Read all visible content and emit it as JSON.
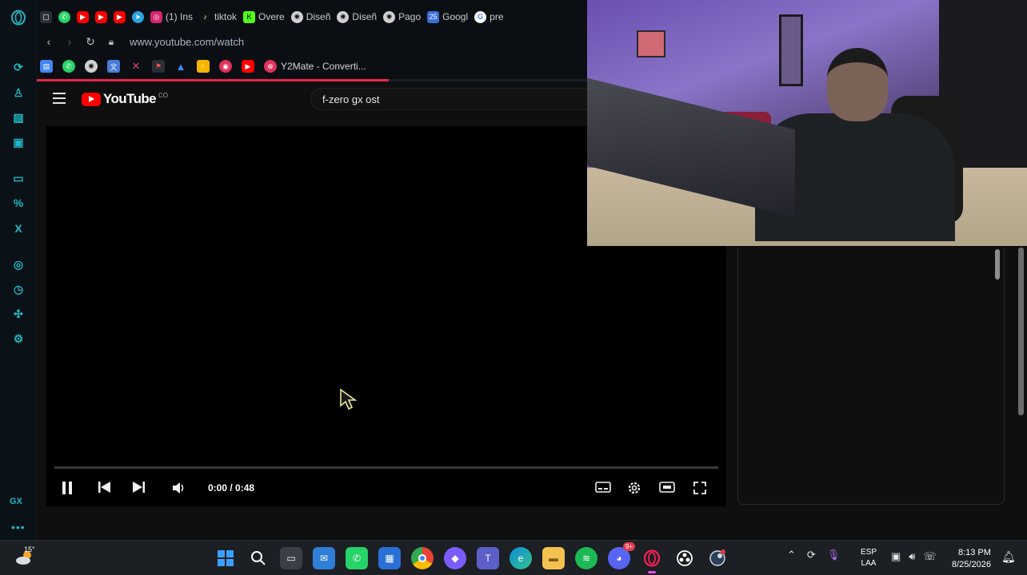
{
  "browser": {
    "tabs": [
      {
        "icon": "whatsapp-icon",
        "label": "",
        "color": "#25d366"
      },
      {
        "icon": "youtube-icon",
        "label": "",
        "color": "#ff0000"
      },
      {
        "icon": "youtube-icon",
        "label": "",
        "color": "#ff0000"
      },
      {
        "icon": "youtube-icon",
        "label": "",
        "color": "#ff0000"
      },
      {
        "icon": "telegram-icon",
        "label": "",
        "color": "#2aa3e0"
      },
      {
        "icon": "instagram-icon",
        "label": "(1) Ins",
        "color": "#d6246e"
      },
      {
        "icon": "tiktok-icon",
        "label": "tiktok",
        "color": "#111111"
      },
      {
        "icon": "kick-icon",
        "label": "Overe",
        "color": "#53fc18"
      },
      {
        "icon": "chatgpt-icon",
        "label": "Diseñ",
        "color": "#d0d0d0"
      },
      {
        "icon": "chatgpt-icon",
        "label": "Diseñ",
        "color": "#d0d0d0"
      },
      {
        "icon": "chatgpt-icon",
        "label": "Pago",
        "color": "#d0d0d0"
      },
      {
        "icon": "calendar-icon",
        "label": "Googl",
        "color": "#3b6fd8"
      },
      {
        "icon": "google-icon",
        "label": "pre",
        "color": "#ffffff"
      }
    ],
    "address": {
      "url": "www.youtube.com/watch"
    },
    "bookmarks": {
      "y2mate": "Y2Mate - Converti..."
    }
  },
  "youtube": {
    "logo_text": "YouTube",
    "country_code": "CO",
    "search_value": "f-zero gx ost",
    "player": {
      "time": "0:00 / 0:48",
      "progress": 0
    }
  },
  "taskbar": {
    "temperature": "15°",
    "language_top": "ESP",
    "language_bottom": "LAA",
    "time": "8:13 PM",
    "date": "8/25/2026",
    "discord_badge": "9+"
  },
  "colors": {
    "accent": "#1fb7c6",
    "youtube_red": "#ff0000",
    "opera_red": "#e8264a"
  }
}
